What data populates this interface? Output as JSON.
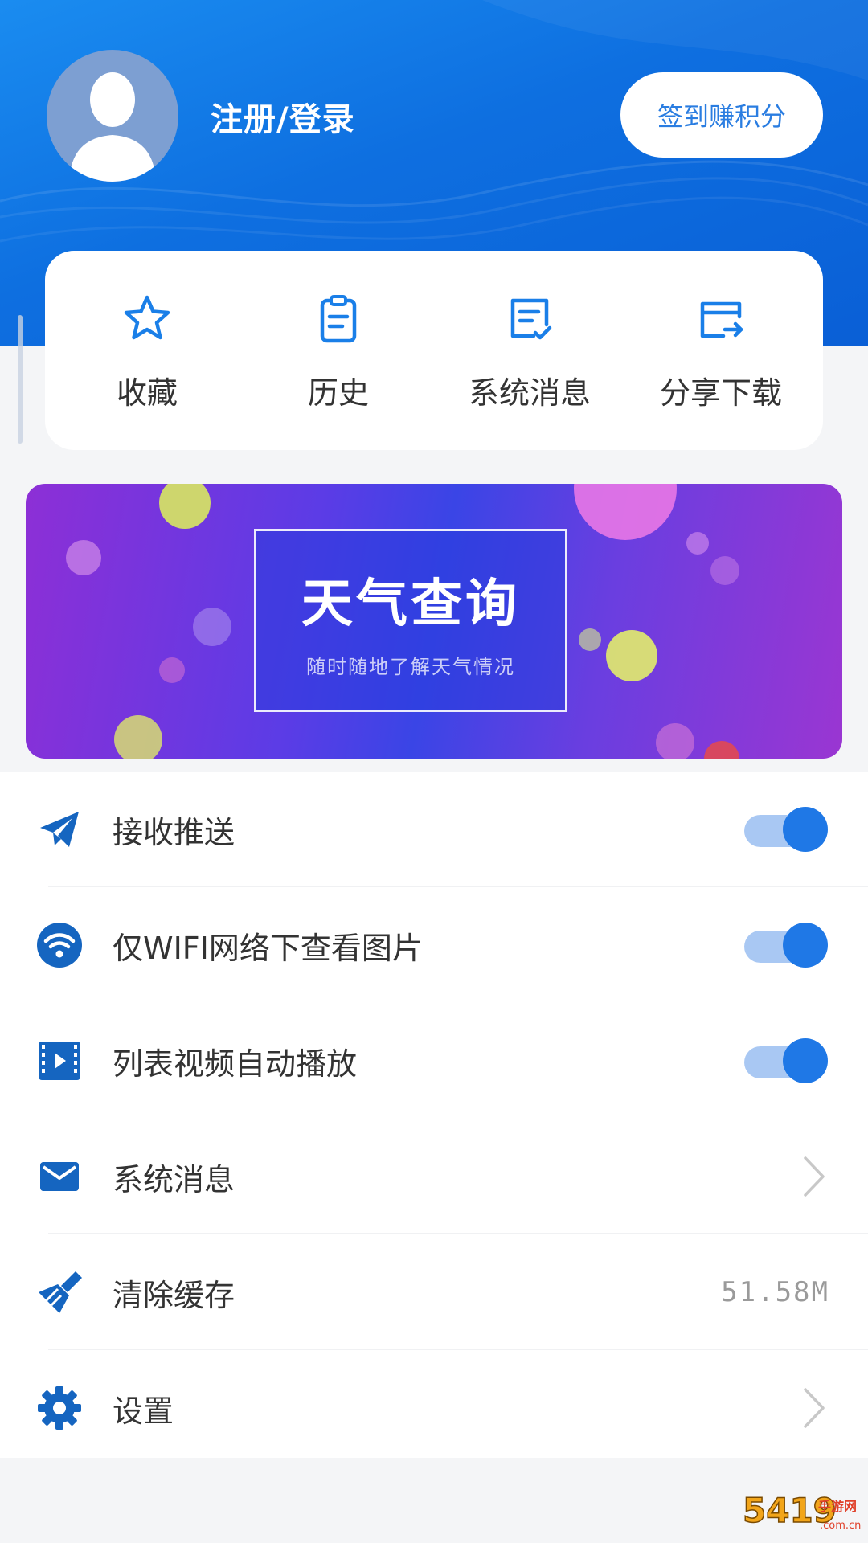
{
  "header": {
    "login_label": "注册/登录",
    "signin_button": "签到赚积分",
    "avatar_icon": "user-silhouette-icon"
  },
  "quick_actions": [
    {
      "label": "收藏",
      "icon": "star-icon"
    },
    {
      "label": "历史",
      "icon": "clipboard-icon"
    },
    {
      "label": "系统消息",
      "icon": "message-check-icon"
    },
    {
      "label": "分享下载",
      "icon": "share-card-icon"
    }
  ],
  "banner": {
    "title": "天气查询",
    "subtitle": "随时随地了解天气情况"
  },
  "settings": [
    {
      "label": "接收推送",
      "icon": "paper-plane-icon",
      "control": "toggle",
      "enabled": true
    },
    {
      "label": "仅WIFI网络下查看图片",
      "icon": "wifi-icon",
      "control": "toggle",
      "enabled": true
    },
    {
      "label": "列表视频自动播放",
      "icon": "video-play-icon",
      "control": "toggle",
      "enabled": true
    },
    {
      "label": "系统消息",
      "icon": "mail-icon",
      "control": "chevron"
    },
    {
      "label": "清除缓存",
      "icon": "broom-icon",
      "control": "value",
      "value": "51.58M"
    },
    {
      "label": "设置",
      "icon": "gear-icon",
      "control": "chevron"
    }
  ],
  "watermark": {
    "text": "5419",
    "suffix": "手游网",
    "domain": ".com.cn"
  },
  "colors": {
    "accent": "#1f78e6",
    "header_start": "#1a8cf0",
    "header_end": "#0a5fd6",
    "toggle_track": "#a9c8f3",
    "icon_blue": "#1565c0"
  }
}
